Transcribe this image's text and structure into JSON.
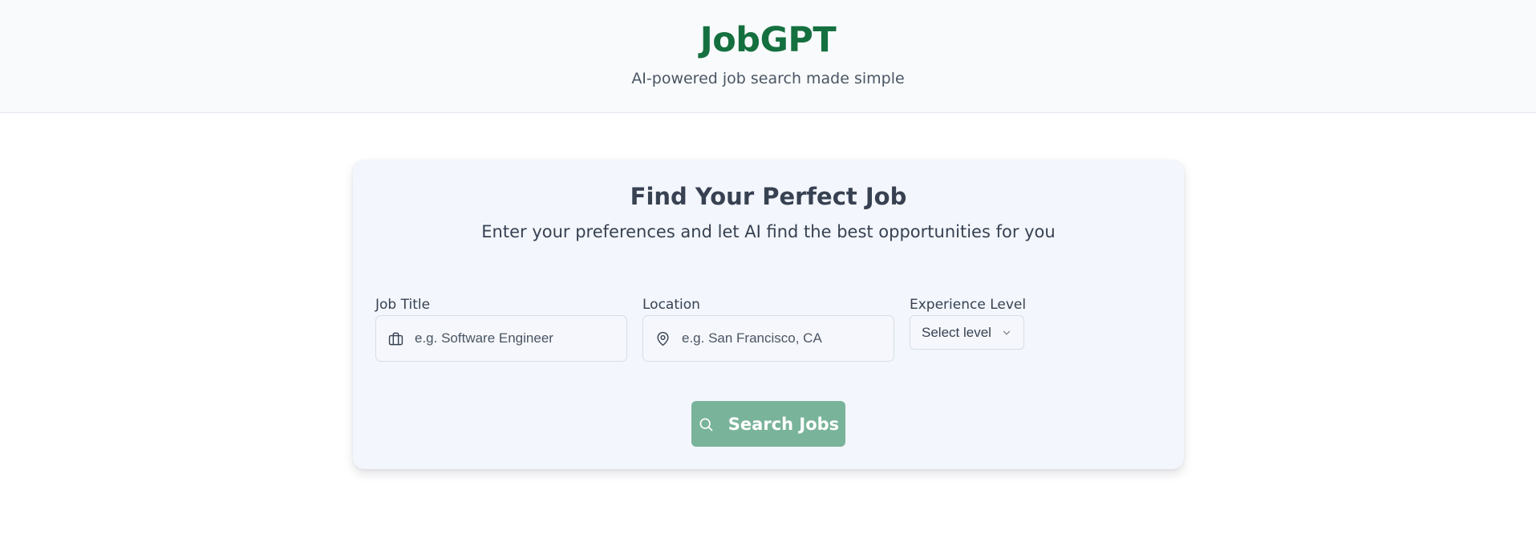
{
  "header": {
    "brand": "JobGPT",
    "tagline": "AI-powered job search made simple"
  },
  "search_card": {
    "title": "Find Your Perfect Job",
    "subtitle": "Enter your preferences and let AI find the best opportunities for you",
    "job_title": {
      "label": "Job Title",
      "placeholder": "e.g. Software Engineer",
      "value": "",
      "icon": "briefcase-icon"
    },
    "location": {
      "label": "Location",
      "placeholder": "e.g. San Francisco, CA",
      "value": "",
      "icon": "map-pin-icon"
    },
    "experience": {
      "label": "Experience Level",
      "selected": "Select level",
      "icon": "chevron-down-icon"
    },
    "search_button": {
      "label": "Search Jobs",
      "icon": "search-icon"
    }
  },
  "colors": {
    "brand": "#15703f",
    "button": "#79b39a",
    "header_bg": "#f8fafc",
    "card_bg": "#f3f6fc"
  }
}
